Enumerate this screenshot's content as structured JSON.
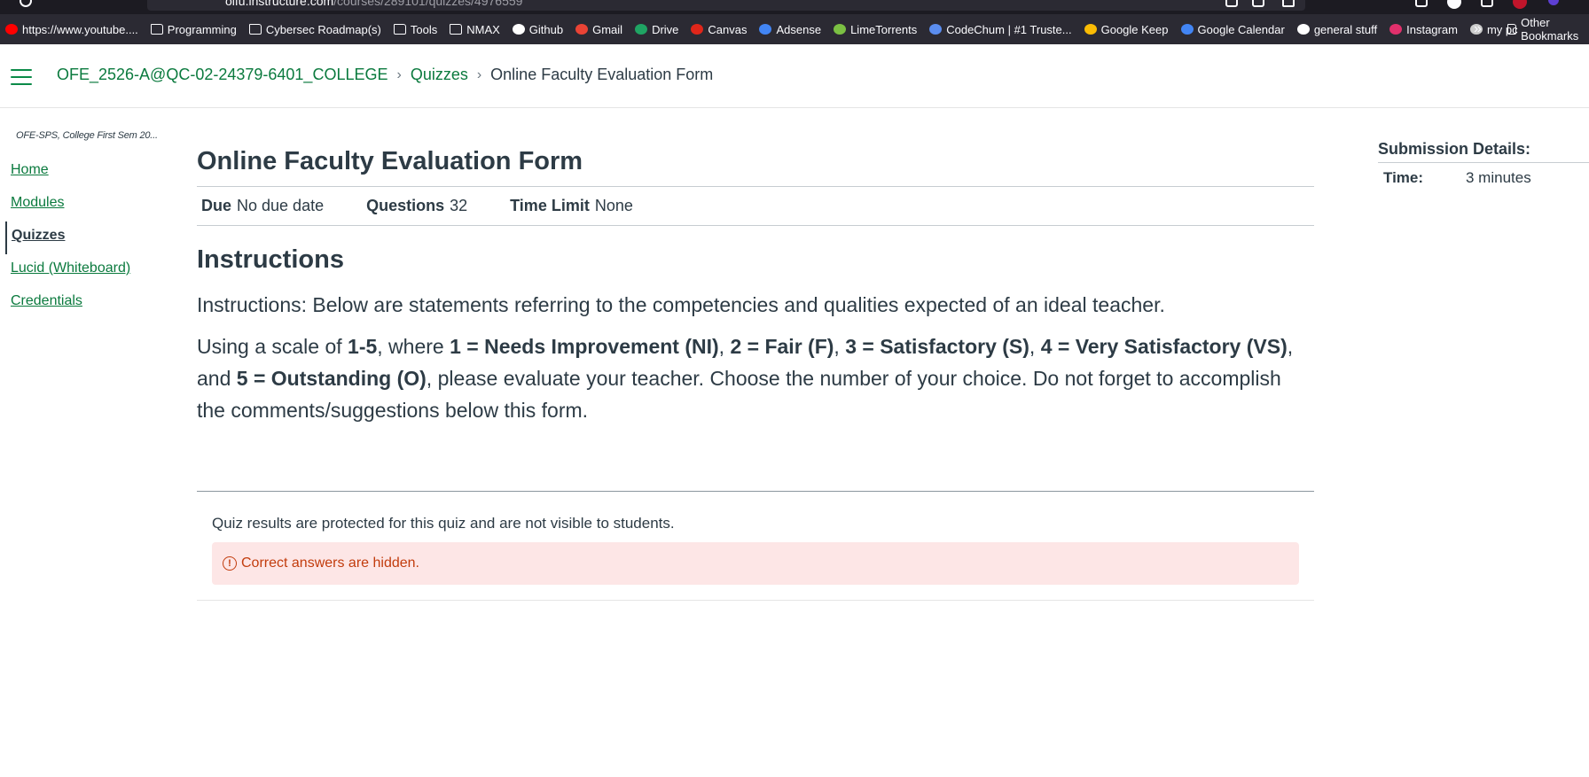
{
  "browser": {
    "url_host": "olfu.instructure.com",
    "url_path": "/courses/289101/quizzes/4976559",
    "url_prefix": "olfu."
  },
  "bookmarks": [
    {
      "label": "https://www.youtube....",
      "icon": "youtube-icon",
      "color": "#ff0000"
    },
    {
      "label": "Programming",
      "icon": "folder-icon"
    },
    {
      "label": "Cybersec Roadmap(s)",
      "icon": "folder-icon"
    },
    {
      "label": "Tools",
      "icon": "folder-icon"
    },
    {
      "label": "NMAX",
      "icon": "folder-icon"
    },
    {
      "label": "Github",
      "icon": "github-icon",
      "color": "#ffffff"
    },
    {
      "label": "Gmail",
      "icon": "gmail-icon",
      "color": "#ea4335"
    },
    {
      "label": "Drive",
      "icon": "drive-icon",
      "color": "#1fa463"
    },
    {
      "label": "Canvas",
      "icon": "canvas-icon",
      "color": "#e0261a"
    },
    {
      "label": "Adsense",
      "icon": "google-icon",
      "color": "#4285f4"
    },
    {
      "label": "LimeTorrents",
      "icon": "lime-icon",
      "color": "#7bc043"
    },
    {
      "label": "CodeChum | #1 Truste...",
      "icon": "codechum-icon",
      "color": "#5b8def"
    },
    {
      "label": "Google Keep",
      "icon": "keep-icon",
      "color": "#fbbc04"
    },
    {
      "label": "Google Calendar",
      "icon": "calendar-icon",
      "color": "#4285f4"
    },
    {
      "label": "general stuff",
      "icon": "chatgpt-icon",
      "color": "#ffffff"
    },
    {
      "label": "Instagram",
      "icon": "instagram-icon",
      "color": "#e1306c"
    },
    {
      "label": "my pc",
      "icon": "pc-icon",
      "color": "#cccccc"
    }
  ],
  "bookmarks_other": "Other Bookmarks",
  "breadcrumb": {
    "course": "OFE_2526-A@QC-02-24379-6401_COLLEGE",
    "section": "Quizzes",
    "current": "Online Faculty Evaluation Form"
  },
  "course_nav": {
    "course_name": "OFE-SPS, College First Sem 20...",
    "items": [
      "Home",
      "Modules",
      "Quizzes",
      "Lucid (Whiteboard)",
      "Credentials"
    ],
    "active": "Quizzes"
  },
  "quiz": {
    "title": "Online Faculty Evaluation Form",
    "due_label": "Due",
    "due_value": "No due date",
    "questions_label": "Questions",
    "questions_value": "32",
    "time_limit_label": "Time Limit",
    "time_limit_value": "None",
    "instructions_heading": "Instructions",
    "instructions_p1": "Instructions: Below are statements referring to the competencies and qualities expected of an ideal teacher.",
    "p2": {
      "t1": "Using a scale of ",
      "b1": "1-5",
      "t2": ", where ",
      "b2": "1 = Needs Improvement (NI)",
      "t3": ", ",
      "b3": "2 = Fair (F)",
      "t4": ", ",
      "b4": "3 = Satisfactory (S)",
      "t5": ", ",
      "b5": "4 = Very Satisfactory (VS)",
      "t6": ", and ",
      "b6": "5 = Outstanding (O)",
      "t7": ", please evaluate your teacher. Choose the number of your choice. Do not forget to accomplish the comments/suggestions below this form."
    },
    "results_note": "Quiz results are protected for this quiz and are not visible to students.",
    "alert_text": "Correct answers are hidden."
  },
  "submission": {
    "heading": "Submission Details:",
    "time_label": "Time:",
    "time_value": "3 minutes"
  },
  "colors": {
    "link": "#0b7a3e",
    "alert_bg": "#fde6e6",
    "alert_text": "#c23c0d"
  }
}
